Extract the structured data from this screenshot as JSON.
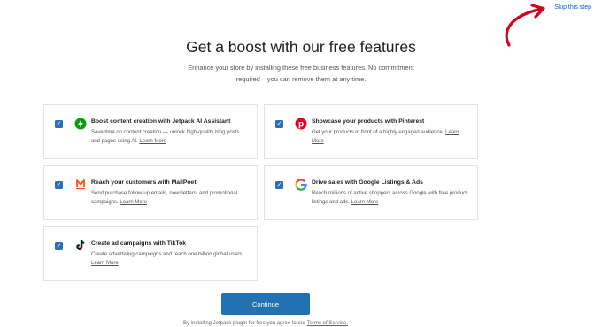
{
  "skip_label": "Skip this step",
  "header": {
    "title": "Get a boost with our free features",
    "subtitle_line1": "Enhance your store by installing these free business features. No commitment",
    "subtitle_line2": "required – you can remove them at any time."
  },
  "features": [
    {
      "title": "Boost content creation with Jetpack AI Assistant",
      "description": "Save time on content creation — unlock high-quality blog posts and pages using AI.",
      "link": "Learn More",
      "icon": "jetpack-icon",
      "checked": true
    },
    {
      "title": "Showcase your products with Pinterest",
      "description": "Get your products in front of a highly engaged audience.",
      "link": "Learn More",
      "icon": "pinterest-icon",
      "checked": true
    },
    {
      "title": "Reach your customers with MailPoet",
      "description": "Send purchase follow-up emails, newsletters, and promotional campaigns.",
      "link": "Learn More",
      "icon": "mailpoet-icon",
      "checked": true
    },
    {
      "title": "Drive sales with Google Listings & Ads",
      "description": "Reach millions of active shoppers across Google with free product listings and ads.",
      "link": "Learn More",
      "icon": "google-icon",
      "checked": true
    },
    {
      "title": "Create ad campaigns with TikTok",
      "description": "Create advertising campaigns and reach one billion global users.",
      "link": "Learn More",
      "icon": "tiktok-icon",
      "checked": true
    }
  ],
  "continue_label": "Continue",
  "footer": {
    "text": "By installing Jetpack plugin for free you agree to our",
    "tos_link": "Terms of Service."
  },
  "colors": {
    "accent": "#2271b1",
    "checkbox": "#2a6fb8",
    "arrow": "#d0021b"
  }
}
